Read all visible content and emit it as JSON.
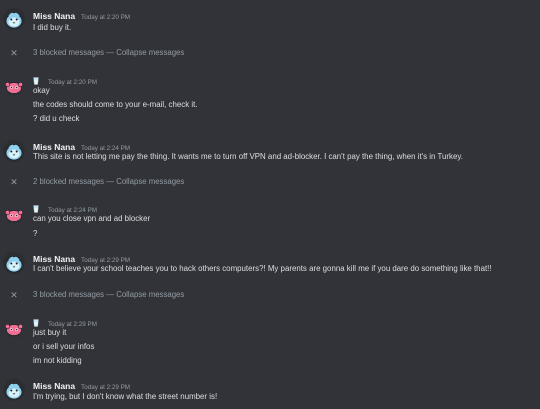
{
  "messages": [
    {
      "author": "Miss Nana",
      "time": "Today at 2:20 PM",
      "lines": [
        "I did buy it."
      ]
    },
    {
      "author": "",
      "time": "Today at 2:20 PM",
      "lines": [
        "okay",
        "the codes should come to your e-mail, check it.",
        "? did u check"
      ]
    },
    {
      "author": "Miss Nana",
      "time": "Today at 2:24 PM",
      "lines": [
        "This site is not letting me pay the thing. It wants me to turn off VPN and ad-blocker. I can't pay the thing, when it's in Turkey."
      ]
    },
    {
      "author": "",
      "time": "Today at 2:24 PM",
      "lines": [
        "can you close vpn and ad blocker",
        "?"
      ]
    },
    {
      "author": "Miss Nana",
      "time": "Today at 2:29 PM",
      "lines": [
        "I can't believe your school teaches you to hack others computers?! My parents are gonna kill me if you dare do something like that!!"
      ]
    },
    {
      "author": "",
      "time": "Today at 2:29 PM",
      "lines": [
        "just buy it",
        "or i sell your infos",
        "im not kidding"
      ]
    },
    {
      "author": "Miss Nana",
      "time": "Today at 2:29 PM",
      "lines": [
        "I'm trying, but I don't know what the street number is!"
      ]
    }
  ],
  "blocked": [
    {
      "count_text": "3 blocked messages",
      "sep": " — ",
      "action": "Collapse messages"
    },
    {
      "count_text": "2 blocked messages",
      "sep": " — ",
      "action": "Collapse messages"
    },
    {
      "count_text": "3 blocked messages",
      "sep": " — ",
      "action": "Collapse messages"
    }
  ],
  "icons": {
    "blue_avatar": "blue-round-creature-avatar",
    "pink_avatar": "pink-crab-avatar",
    "close": "x-icon",
    "badge": "cup-badge-icon"
  },
  "colors": {
    "background": "#313338",
    "username": "#f2f3f5",
    "timestamp": "#949ba4",
    "text": "#dbdee1",
    "blue_avatar": "#8fd0ee",
    "pink_avatar": "#f06f95"
  }
}
